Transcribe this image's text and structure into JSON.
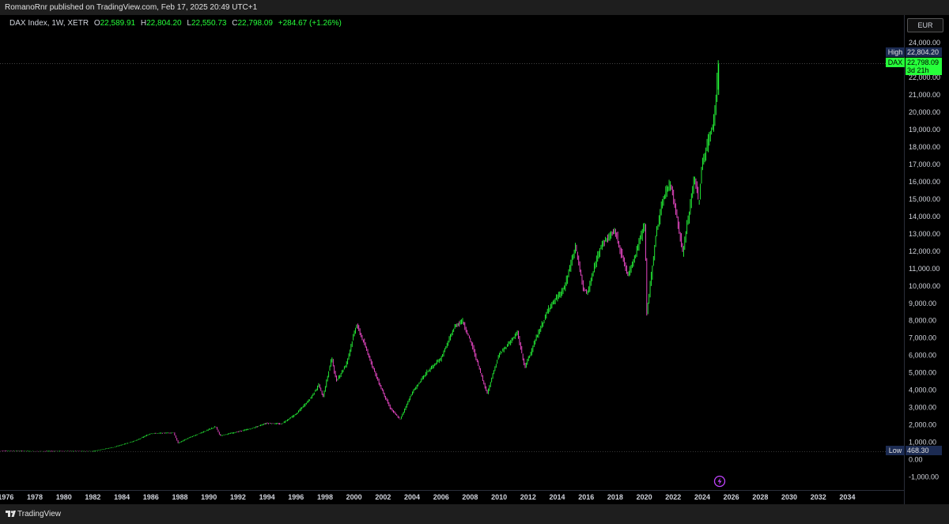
{
  "header": {
    "published_by": "RomanoRnr published on TradingView.com, Feb 17, 2025 20:49 UTC+1"
  },
  "legend": {
    "symbol": "DAX Index, 1W, XETR",
    "open_label": "O",
    "open_value": "22,589.91",
    "high_label": "H",
    "high_value": "22,804.20",
    "low_label": "L",
    "low_value": "22,550.73",
    "close_label": "C",
    "close_value": "22,798.09",
    "change": "+284.67 (+1.26%)"
  },
  "currency_button": "EUR",
  "price_tags": {
    "high_label": "High",
    "high_value": "22,804.20",
    "symbol_label": "DAX",
    "last_value": "22,798.09",
    "countdown": "3d 21h",
    "low_label": "Low",
    "low_value": "468.30"
  },
  "footer": {
    "brand": "TradingView"
  },
  "colors": {
    "up": "#26ff3a",
    "down": "#ff4fd8",
    "background": "#000000",
    "axis_text": "#d1d4dc",
    "tag_blue": "#1c2b52"
  },
  "chart_data": {
    "type": "line",
    "title": "DAX Index, 1W, XETR",
    "xlabel": "",
    "ylabel": "",
    "x_ticks": [
      "1976",
      "1978",
      "1980",
      "1982",
      "1984",
      "1986",
      "1988",
      "1990",
      "1992",
      "1994",
      "1996",
      "1998",
      "2000",
      "2002",
      "2004",
      "2006",
      "2008",
      "2010",
      "2012",
      "2014",
      "2016",
      "2018",
      "2020",
      "2022",
      "2024",
      "2026",
      "2028",
      "2030",
      "2032",
      "2034"
    ],
    "y_ticks": [
      "24,000.00",
      "22,000.00",
      "21,000.00",
      "20,000.00",
      "19,000.00",
      "18,000.00",
      "17,000.00",
      "16,000.00",
      "15,000.00",
      "14,000.00",
      "13,000.00",
      "12,000.00",
      "11,000.00",
      "10,000.00",
      "9,000.00",
      "8,000.00",
      "7,000.00",
      "6,000.00",
      "5,000.00",
      "4,000.00",
      "3,000.00",
      "2,000.00",
      "1,000.00",
      "0.00",
      "-1,000.00"
    ],
    "xlim": [
      1975.6,
      2037.9
    ],
    "ylim": [
      -1750,
      25600
    ],
    "y_scale": "linear",
    "grid": false,
    "high_level": 22804.2,
    "low_level": 468.3,
    "series": [
      {
        "x": [
          1975.6,
          1978,
          1980,
          1982,
          1983.5,
          1985,
          1986,
          1987.6,
          1987.9,
          1988.5,
          1990.5,
          1990.8,
          1992,
          1993,
          1994,
          1995,
          1996,
          1997,
          1997.6,
          1997.9,
          1998.5,
          1998.8,
          1999.5,
          2000.2,
          2000.9,
          2001.7,
          2002.5,
          2003.2,
          2004,
          2005,
          2006,
          2007,
          2007.5,
          2008.2,
          2009.2,
          2010,
          2011.3,
          2011.8,
          2012.5,
          2013.5,
          2014.5,
          2015.3,
          2015.8,
          2016.1,
          2017,
          2018,
          2018.9,
          2019.5,
          2020.1,
          2020.2,
          2020.9,
          2021.5,
          2021.9,
          2022.7,
          2023.5,
          2023.8,
          2024,
          2024.5,
          2024.8,
          2025.0,
          2025.13
        ],
        "y": [
          520,
          480,
          490,
          480,
          720,
          1100,
          1500,
          1550,
          950,
          1200,
          1900,
          1380,
          1600,
          1800,
          2100,
          2050,
          2600,
          3500,
          4300,
          3600,
          5900,
          4500,
          5500,
          7800,
          6300,
          4500,
          3000,
          2300,
          3800,
          5000,
          5800,
          7700,
          8000,
          6500,
          3800,
          6000,
          7300,
          5300,
          6800,
          8800,
          9800,
          12300,
          10000,
          9500,
          12300,
          13200,
          10600,
          12000,
          13700,
          8300,
          13300,
          15500,
          15800,
          11900,
          16300,
          14700,
          16900,
          18500,
          19300,
          21000,
          22798
        ]
      }
    ]
  }
}
